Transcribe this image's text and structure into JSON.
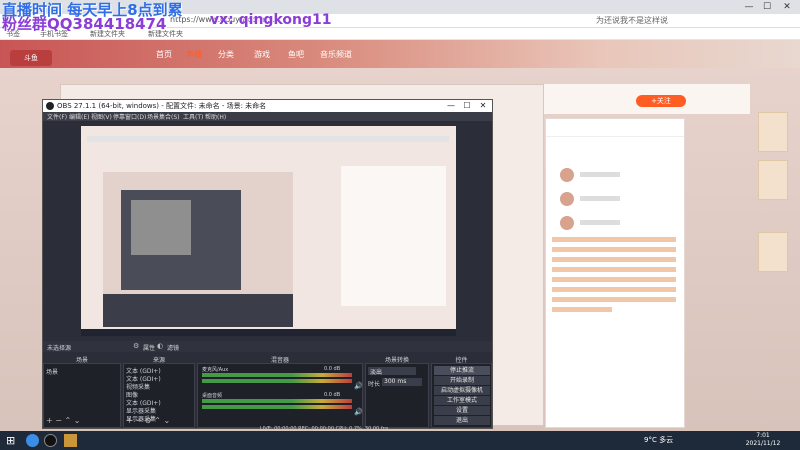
{
  "browser": {
    "url": "https://www.douyu.com/...",
    "search_hint": "为还说我不是这样说",
    "bookmarks": [
      "书签",
      "手机书签",
      "新建文件夹",
      "新建文件夹"
    ]
  },
  "site": {
    "logo": "斗鱼",
    "nav": [
      "首页",
      "直播",
      "分类",
      "游戏",
      "鱼吧",
      "音乐频道"
    ],
    "nav_active_index": 1,
    "follow_label": "+关注"
  },
  "overlay": {
    "line1": "直播时间 每天早上8点到累",
    "line2": "粉丝群QQ384418474",
    "vx": "vx: qingkong11"
  },
  "obs": {
    "title": "OBS 27.1.1 (64-bit, windows) - 配置文件: 未命名 - 场景: 未命名",
    "menu": [
      "文件(F)",
      "编辑(E)",
      "视图(V)",
      "停靠窗口(D)",
      "场景集合(S)",
      "工具(T)",
      "帮助(H)"
    ],
    "scene_label": "未选择源",
    "properties_label": "属性",
    "filters_label": "滤镜",
    "docks": {
      "scenes_title": "场景",
      "sources_title": "来源",
      "mixer_title": "混音器",
      "transitions_title": "场景转换",
      "controls_title": "控件"
    },
    "scenes": [
      "场景"
    ],
    "sources": [
      "文本 (GDI+)",
      "文本 (GDI+)",
      "视频采集",
      "图像",
      "文本 (GDI+)",
      "显示器采集",
      "显示器采集"
    ],
    "mixer": [
      {
        "name": "麦克风/Aux",
        "db": "0.0 dB"
      },
      {
        "name": "桌面音频",
        "db": "0.0 dB"
      }
    ],
    "transition": {
      "type": "淡出",
      "duration_label": "时长",
      "duration": "300 ms"
    },
    "controls": [
      "停止推流",
      "开始录制",
      "启动虚拟摄像机",
      "工作室模式",
      "设置",
      "退出"
    ],
    "status": "LIVE: 00:00:00   REC: 00:00:00   CPU: 0.7%, 30.00 fps"
  },
  "taskbar": {
    "weather": "9°C 多云",
    "time": "7:01",
    "date": "2021/11/12"
  },
  "colors": {
    "accent": "#ff5d23",
    "overlay_blue": "#2f6ee6",
    "overlay_purple": "#8b3dd8",
    "obs_bg": "#2b2e38",
    "taskbar": "#1e2a3a"
  }
}
